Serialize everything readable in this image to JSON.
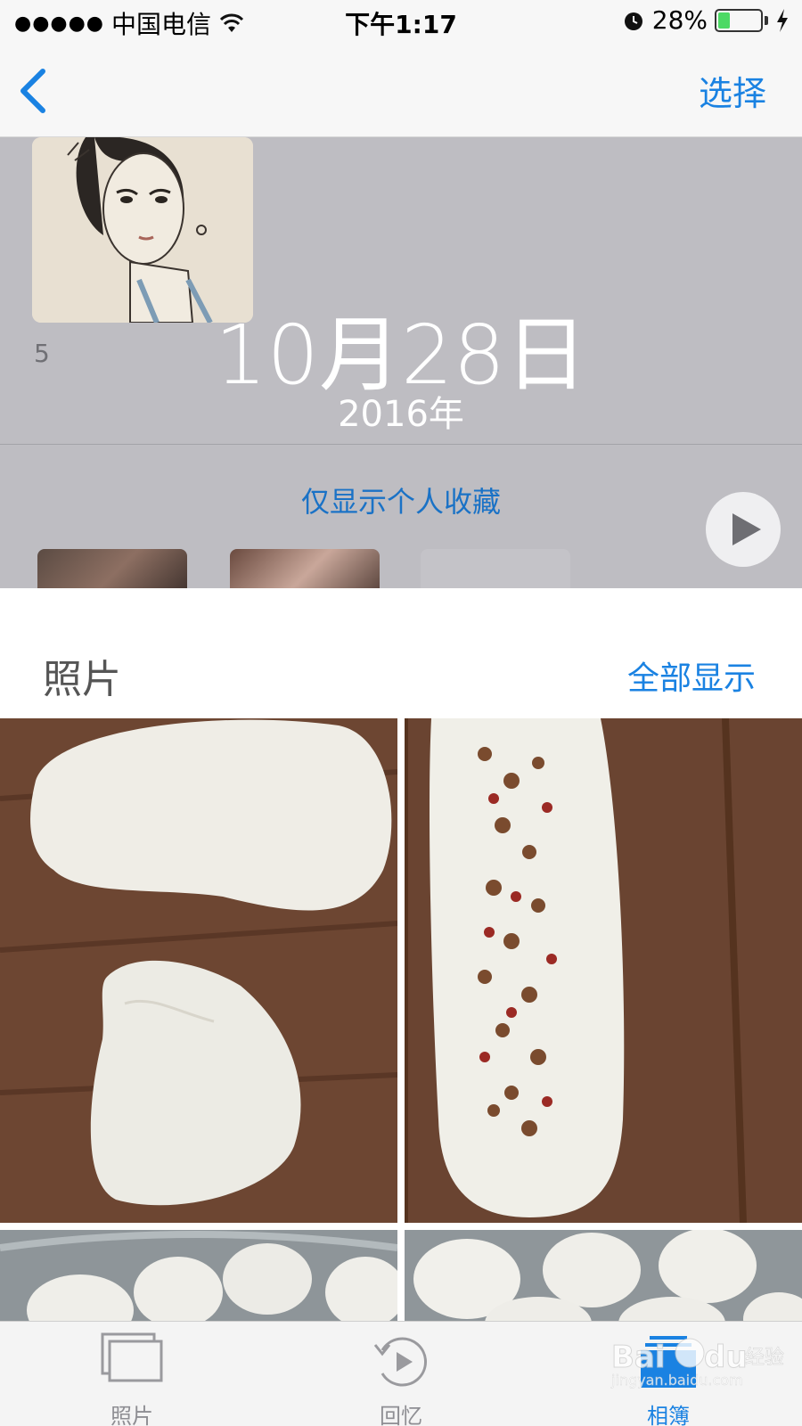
{
  "status_bar": {
    "signal": "●●●●●",
    "carrier": "中国电信",
    "time": "下午1:17",
    "battery_percent_label": "28%",
    "battery_level": 0.28
  },
  "nav": {
    "select_label": "选择"
  },
  "memory": {
    "count": "5",
    "date": "10月28日",
    "year": "2016年",
    "favorites_link": "仅显示个人收藏"
  },
  "photos_section": {
    "title": "照片",
    "show_all_label": "全部显示"
  },
  "tabs": [
    {
      "label": "照片",
      "icon": "photos-icon",
      "active": false
    },
    {
      "label": "回忆",
      "icon": "memories-icon",
      "active": false
    },
    {
      "label": "相簿",
      "icon": "albums-icon",
      "active": true
    }
  ],
  "watermark": {
    "brand": "Bai du 经验",
    "url": "jingyan.baidu.com"
  },
  "colors": {
    "accent": "#1a82e2",
    "battery_fill": "#4cd964",
    "overlay_grey": "#bebdc2"
  }
}
